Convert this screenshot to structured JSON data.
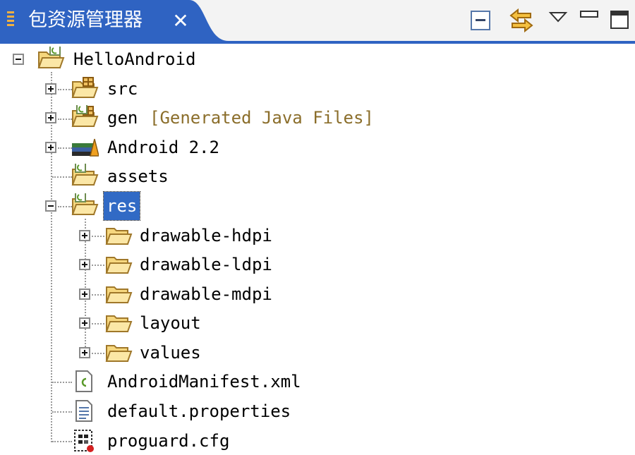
{
  "view": {
    "title": "包资源管理器",
    "close_glyph": "✕",
    "toolbar": [
      "collapse-all-icon",
      "link-with-editor-icon",
      "view-menu-icon",
      "minimize-icon",
      "maximize-icon"
    ],
    "colors": {
      "tab_active": "#2f63c2",
      "selection": "#316ac5",
      "decoration": "#8b6e2b"
    }
  },
  "tree": {
    "project": {
      "label": "HelloAndroid",
      "expanded": true
    },
    "src": {
      "label": "src",
      "expanded": false
    },
    "gen": {
      "label": "gen",
      "decoration": "[Generated Java Files]",
      "expanded": false
    },
    "android_lib": {
      "label": "Android 2.2",
      "expanded": false
    },
    "assets": {
      "label": "assets"
    },
    "res": {
      "label": "res",
      "expanded": true,
      "selected": true,
      "children": [
        {
          "label": "drawable-hdpi"
        },
        {
          "label": "drawable-ldpi"
        },
        {
          "label": "drawable-mdpi"
        },
        {
          "label": "layout"
        },
        {
          "label": "values"
        }
      ]
    },
    "manifest": {
      "label": "AndroidManifest.xml"
    },
    "default_properties": {
      "label": "default.properties"
    },
    "proguard": {
      "label": "proguard.cfg"
    }
  }
}
